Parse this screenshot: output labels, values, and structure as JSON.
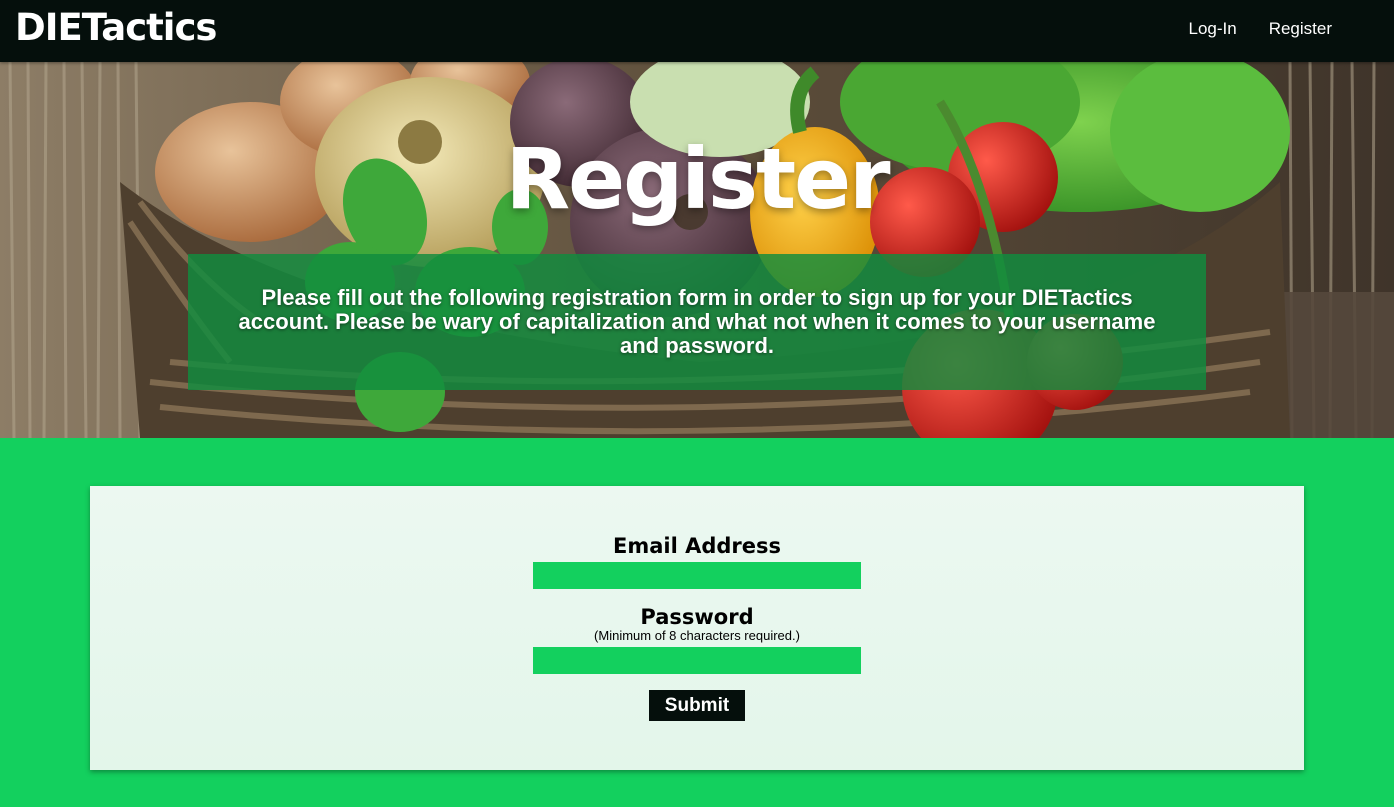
{
  "navbar": {
    "brand": "DIETactics",
    "links": [
      {
        "label": "Log-In"
      },
      {
        "label": "Register"
      }
    ]
  },
  "hero": {
    "title": "Register",
    "description": "Please fill out the following registration form in order to sign up for your DIETactics account. Please be wary of capitalization and what not when it comes to your username and password.",
    "background_image": "vegetable-basket-photo"
  },
  "form": {
    "email": {
      "label": "Email Address",
      "value": "",
      "placeholder": ""
    },
    "password": {
      "label": "Password",
      "note": "(Minimum of 8 characters required.)",
      "value": "",
      "placeholder": ""
    },
    "submit_label": "Submit"
  },
  "colors": {
    "brand_green": "#13d05e",
    "navbar_dark": "#050f0c",
    "overlay_green": "#108c3e",
    "card_bg": "#ecf8f1"
  }
}
